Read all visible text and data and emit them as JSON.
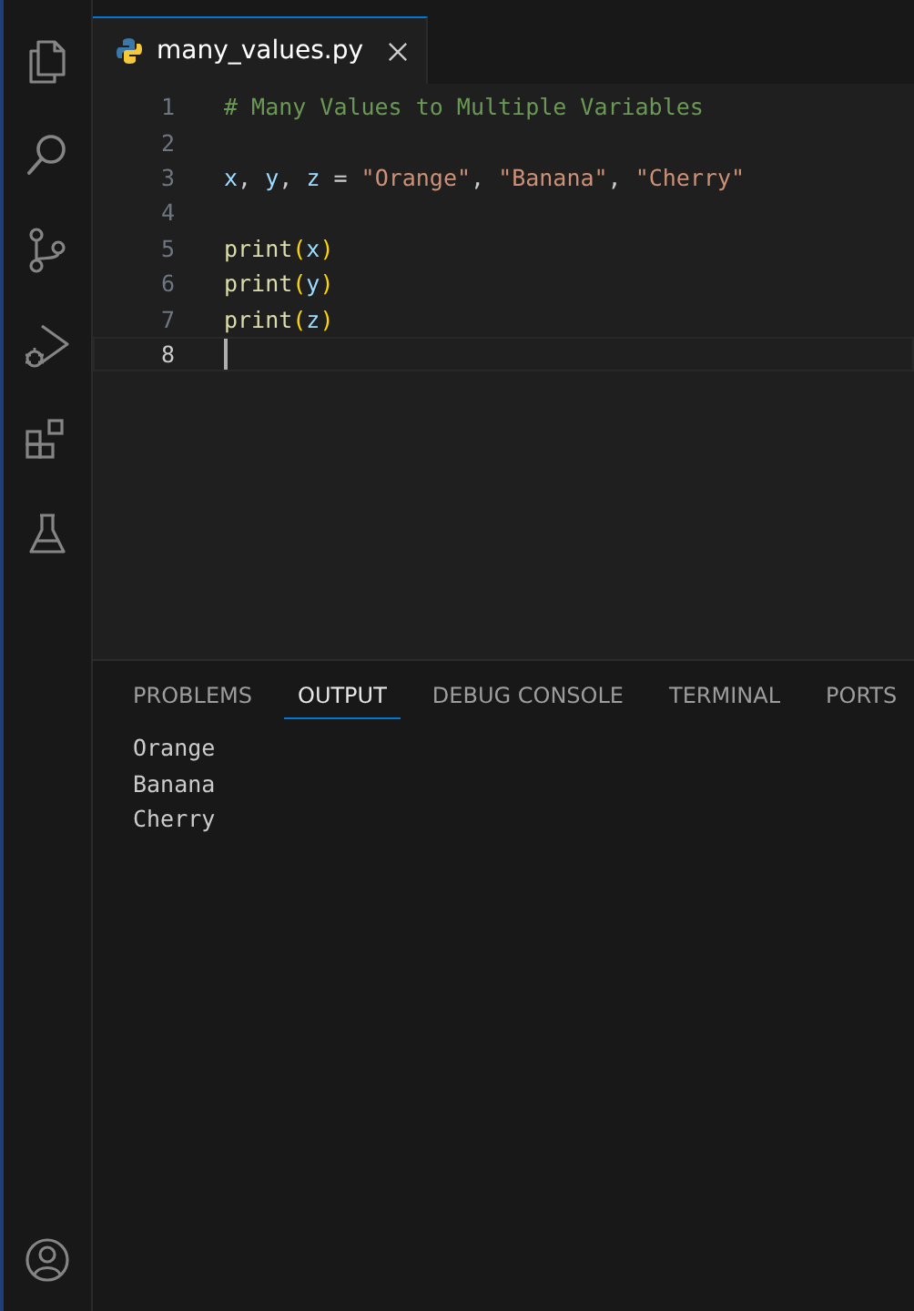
{
  "activity_bar": {
    "items": [
      {
        "kind": "files",
        "selected": false
      },
      {
        "kind": "search",
        "selected": false
      },
      {
        "kind": "source-control",
        "selected": false
      },
      {
        "kind": "run-debug",
        "selected": false
      },
      {
        "kind": "extensions",
        "selected": false
      },
      {
        "kind": "testing",
        "selected": false
      }
    ],
    "account": {
      "kind": "account"
    }
  },
  "tabs": [
    {
      "label": "many_values.py",
      "selected": true
    }
  ],
  "editor": {
    "lines": [
      {
        "number": "1",
        "current": false,
        "tokens": [
          {
            "text": "# Many Values to Multiple Variables",
            "kind": "comment"
          }
        ]
      },
      {
        "number": "2",
        "current": false
      },
      {
        "number": "3",
        "current": false,
        "tokens": [
          {
            "text": "x",
            "kind": "var"
          },
          {
            "text": ", ",
            "kind": "plain"
          },
          {
            "text": "y",
            "kind": "var"
          },
          {
            "text": ", ",
            "kind": "plain"
          },
          {
            "text": "z",
            "kind": "var"
          },
          {
            "text": " = ",
            "kind": "plain"
          },
          {
            "text": "\"Orange\"",
            "kind": "string"
          },
          {
            "text": ", ",
            "kind": "plain"
          },
          {
            "text": "\"Banana\"",
            "kind": "string"
          },
          {
            "text": ", ",
            "kind": "plain"
          },
          {
            "text": "\"Cherry\"",
            "kind": "string"
          }
        ]
      },
      {
        "number": "4",
        "current": false
      },
      {
        "number": "5",
        "current": false,
        "tokens": [
          {
            "text": "print",
            "kind": "func"
          },
          {
            "text": "(",
            "kind": "paren"
          },
          {
            "text": "x",
            "kind": "var"
          },
          {
            "text": ")",
            "kind": "paren"
          }
        ]
      },
      {
        "number": "6",
        "current": false,
        "tokens": [
          {
            "text": "print",
            "kind": "func"
          },
          {
            "text": "(",
            "kind": "paren"
          },
          {
            "text": "y",
            "kind": "var"
          },
          {
            "text": ")",
            "kind": "paren"
          }
        ]
      },
      {
        "number": "7",
        "current": false,
        "tokens": [
          {
            "text": "print",
            "kind": "func"
          },
          {
            "text": "(",
            "kind": "paren"
          },
          {
            "text": "z",
            "kind": "var"
          },
          {
            "text": ")",
            "kind": "paren"
          }
        ]
      },
      {
        "number": "8",
        "current": true
      }
    ]
  },
  "panel": {
    "tabs": [
      {
        "label": "PROBLEMS",
        "selected": false
      },
      {
        "label": "OUTPUT",
        "selected": true
      },
      {
        "label": "DEBUG CONSOLE",
        "selected": false
      },
      {
        "label": "TERMINAL",
        "selected": false
      },
      {
        "label": "PORTS",
        "selected": false
      }
    ],
    "output": [
      "Orange",
      "Banana",
      "Cherry"
    ]
  }
}
